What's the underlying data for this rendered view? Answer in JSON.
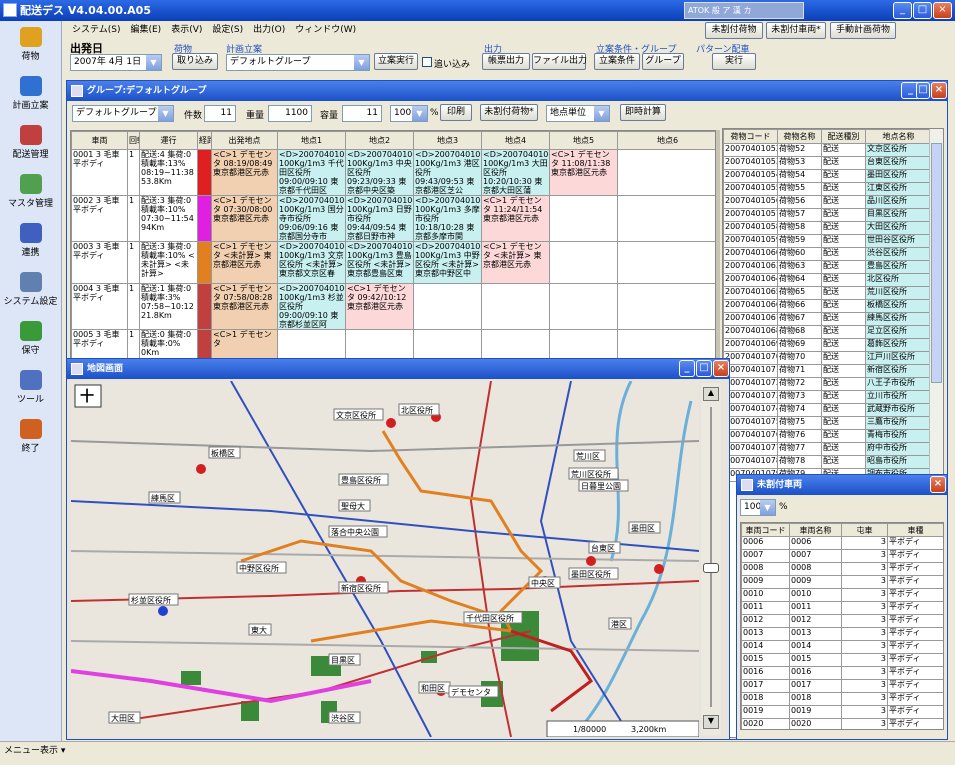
{
  "app": {
    "title": "配送デス V4.04.00.A05"
  },
  "sidebar": [
    {
      "label": "荷物",
      "color": "#e0a020"
    },
    {
      "label": "計画立案",
      "color": "#3070d0"
    },
    {
      "label": "配送管理",
      "color": "#c04040"
    },
    {
      "label": "マスタ管理",
      "color": "#50a050"
    },
    {
      "label": "連携",
      "color": "#4060c0"
    },
    {
      "label": "システム設定",
      "color": "#6080b0"
    },
    {
      "label": "保守",
      "color": "#3a9a3a"
    },
    {
      "label": "ツール",
      "color": "#5070c0"
    },
    {
      "label": "終了",
      "color": "#d06020"
    }
  ],
  "menu": [
    "システム(S)",
    "編集(E)",
    "表示(V)",
    "設定(S)",
    "出力(O)",
    "ウィンドウ(W)"
  ],
  "top_right_buttons": [
    "未割付荷物",
    "未割付車両*",
    "手動計画荷物"
  ],
  "toolbar": {
    "departure_label": "出発日",
    "date": "2007年 4月 1日",
    "cargo_group": "荷物",
    "import_btn": "取り込み",
    "plan_group": "計画立案",
    "plan_select": "デフォルトグループ",
    "exec_btn": "立案実行",
    "append_label": "追い込み",
    "output_group": "出力",
    "report_btn": "帳票出力",
    "file_btn": "ファイル出力",
    "cond_group": "立案条件・グループ",
    "cond_btn": "立案条件",
    "group_btn": "グループ",
    "pattern_group": "パターン配車",
    "pattern_btn": "実行"
  },
  "group_window": {
    "title": "グループ:デフォルトグループ",
    "group_select": "デフォルトグループ",
    "count_label": "件数",
    "count": "11",
    "weight_label": "重量",
    "weight": "1100",
    "volume_label": "容量",
    "volume": "11",
    "zoom": "100",
    "pct": "%",
    "print_btn": "印刷",
    "unassigned_btn": "未割付荷物*",
    "unit_select": "地点単位",
    "calc_btn": "即時計算",
    "headers": [
      "車両",
      "回転",
      "運行",
      "経路",
      "出発地点",
      "地点1",
      "地点2",
      "地点3",
      "地点4",
      "地点5",
      "地点6"
    ],
    "rows": [
      {
        "vehicle": "0001 3 毛車 平ボディ",
        "rot": "1",
        "op": "配送:4 集荷:0 積載率:13% 08:19~11:38 53.8Km",
        "c0": "<C>1 デモセンタ 08:19/08:49 東京都港区元赤",
        "c1": "<D>20070401000 100Kg/1m3 千代田区役所 09:00/09:10 東京都千代田区",
        "c2": "<D>20070401000 100Kg/1m3 中央区役所 09:23/09:33 東京都中央区築",
        "c3": "<D>20070401000 100Kg/1m3 港区役所 09:43/09:53 東京都港区芝公",
        "c4": "<D>20070401001 100Kg/1m3 大田区役所 10:20/10:30 東京都大田区蒲",
        "c5": "<C>1 デモセンタ 11:08/11:38 東京都港区元赤"
      },
      {
        "vehicle": "0002 3 毛車 平ボディ",
        "rot": "1",
        "op": "配送:3 集荷:0 積載率:10% 07:30~11:54 94Km",
        "c0": "<C>1 デモセンタ 07:30/08:00 東京都港区元赤",
        "c1": "<D>20070401000 100Kg/1m3 国分寺市役所 09:06/09:16 東京都国分寺市",
        "c2": "<D>20070401000 100Kg/1m3 日野市役所 09:44/09:54 東京都日野市神",
        "c3": "<D>20070401004 100Kg/1m3 多摩市役所 10:18/10:28 東京都多摩市関",
        "c4": "<C>1 デモセンタ 11:24/11:54 東京都港区元赤",
        "c5": ""
      },
      {
        "vehicle": "0003 3 毛車 平ボディ",
        "rot": "1",
        "op": "配送:3 集荷:0 積載率:10% <未計算> <未計算>",
        "c0": "<C>1 デモセンタ <未計算> 東京都港区元赤",
        "c1": "<D>20070401000 100Kg/1m3 文京区役所 <未計算> 東京都文京区春",
        "c2": "<D>20070401001 100Kg/1m3 豊島区役所 <未計算> 東京都豊島区東",
        "c3": "<D>20070401006 100Kg/1m3 中野区役所 <未計算> 東京都中野区中",
        "c4": "<C>1 デモセンタ <未計算> 東京都港区元赤",
        "c5": ""
      },
      {
        "vehicle": "0004 3 毛車 平ボディ",
        "rot": "1",
        "op": "配送:1 集荷:0 積載率:3% 07:58~10:12 21.8Km",
        "c0": "<C>1 デモセンタ 07:58/08:28 東京都港区元赤",
        "c1": "<D>20070401006 100Kg/1m3 杉並区役所 09:00/09:10 東京都杉並区阿",
        "c2": "<C>1 デモセンタ 09:42/10:12 東京都港区元赤",
        "c3": "",
        "c4": "",
        "c5": ""
      },
      {
        "vehicle": "0005 3 毛車 平ボディ",
        "rot": "1",
        "op": "配送:0 集荷:0 積載率:0% 0Km",
        "c0": "<C>1 デモセンタ",
        "c1": "",
        "c2": "",
        "c3": "",
        "c4": "",
        "c5": ""
      }
    ]
  },
  "cargo_list": {
    "headers": [
      "荷物コード",
      "荷物名称",
      "配送種別",
      "地点名称"
    ],
    "rows": [
      [
        "20070401052",
        "荷物52",
        "配送",
        "文京区役所"
      ],
      [
        "20070401053",
        "荷物53",
        "配送",
        "台東区役所"
      ],
      [
        "20070401054",
        "荷物54",
        "配送",
        "墨田区役所"
      ],
      [
        "20070401055",
        "荷物55",
        "配送",
        "江東区役所"
      ],
      [
        "20070401056",
        "荷物56",
        "配送",
        "品川区役所"
      ],
      [
        "20070401057",
        "荷物57",
        "配送",
        "目黒区役所"
      ],
      [
        "20070401058",
        "荷物58",
        "配送",
        "大田区役所"
      ],
      [
        "20070401059",
        "荷物59",
        "配送",
        "世田谷区役所"
      ],
      [
        "20070401060",
        "荷物60",
        "配送",
        "渋谷区役所"
      ],
      [
        "20070401063",
        "荷物63",
        "配送",
        "豊島区役所"
      ],
      [
        "20070401064",
        "荷物64",
        "配送",
        "北区役所"
      ],
      [
        "20070401065",
        "荷物65",
        "配送",
        "荒川区役所"
      ],
      [
        "20070401066",
        "荷物66",
        "配送",
        "板橋区役所"
      ],
      [
        "20070401067",
        "荷物67",
        "配送",
        "練馬区役所"
      ],
      [
        "20070401068",
        "荷物68",
        "配送",
        "足立区役所"
      ],
      [
        "20070401069",
        "荷物69",
        "配送",
        "葛飾区役所"
      ],
      [
        "20070401070",
        "荷物70",
        "配送",
        "江戸川区役所"
      ],
      [
        "20070401071",
        "荷物71",
        "配送",
        "新宿区役所"
      ],
      [
        "20070401072",
        "荷物72",
        "配送",
        "八王子市役所"
      ],
      [
        "20070401073",
        "荷物73",
        "配送",
        "立川市役所"
      ],
      [
        "20070401074",
        "荷物74",
        "配送",
        "武蔵野市役所"
      ],
      [
        "20070401075",
        "荷物75",
        "配送",
        "三鷹市役所"
      ],
      [
        "20070401076",
        "荷物76",
        "配送",
        "青梅市役所"
      ],
      [
        "20070401077",
        "荷物77",
        "配送",
        "府中市役所"
      ],
      [
        "20070401078",
        "荷物78",
        "配送",
        "昭島市役所"
      ],
      [
        "20070401079",
        "荷物79",
        "配送",
        "調布市役所"
      ]
    ]
  },
  "map_window": {
    "title": "地図画面",
    "scale": "1/80000",
    "distance": "3,200km",
    "labels": [
      "板橋区",
      "北区役所",
      "練馬区",
      "荒川区",
      "荒川区役所",
      "豊島区役所",
      "文京区役所",
      "中野区役所",
      "杉並区役所",
      "新宿区役所",
      "千代田区役所",
      "中央区",
      "台東区",
      "墨田区",
      "港区",
      "目黒区",
      "大田区",
      "日暮里公園",
      "墨田区役所",
      "聖母大",
      "落合中央公園",
      "東大",
      "和田区",
      "デモセンタ",
      "渋谷区"
    ]
  },
  "unassigned_vehicle": {
    "title": "未割付車両",
    "zoom": "100",
    "pct": "%",
    "headers": [
      "車両コード",
      "車両名称",
      "屯車",
      "車種"
    ],
    "rows": [
      [
        "0006",
        "0006",
        "3",
        "平ボディ"
      ],
      [
        "0007",
        "0007",
        "3",
        "平ボディ"
      ],
      [
        "0008",
        "0008",
        "3",
        "平ボディ"
      ],
      [
        "0009",
        "0009",
        "3",
        "平ボディ"
      ],
      [
        "0010",
        "0010",
        "3",
        "平ボディ"
      ],
      [
        "0011",
        "0011",
        "3",
        "平ボディ"
      ],
      [
        "0012",
        "0012",
        "3",
        "平ボディ"
      ],
      [
        "0013",
        "0013",
        "3",
        "平ボディ"
      ],
      [
        "0014",
        "0014",
        "3",
        "平ボディ"
      ],
      [
        "0015",
        "0015",
        "3",
        "平ボディ"
      ],
      [
        "0016",
        "0016",
        "3",
        "平ボディ"
      ],
      [
        "0017",
        "0017",
        "3",
        "平ボディ"
      ],
      [
        "0018",
        "0018",
        "3",
        "平ボディ"
      ],
      [
        "0019",
        "0019",
        "3",
        "平ボディ"
      ],
      [
        "0020",
        "0020",
        "3",
        "平ボディ"
      ]
    ]
  },
  "status": {
    "text": "メニュー表示 ▾"
  }
}
